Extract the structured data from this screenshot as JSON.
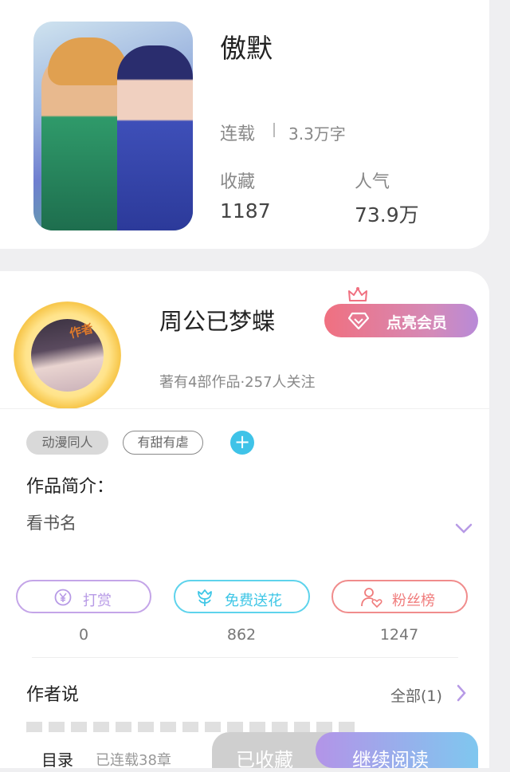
{
  "book": {
    "title": "傲默",
    "status": "连载",
    "word_count": "3.3万字",
    "stats": [
      {
        "label": "收藏",
        "value": "1187"
      },
      {
        "label": "人气",
        "value": "73.9万"
      }
    ]
  },
  "author": {
    "badge": "作者",
    "name": "周公已梦蝶",
    "vip_button": "点亮会员",
    "meta": "著有4部作品·257人关注"
  },
  "tags": [
    "动漫同人",
    "有甜有虐"
  ],
  "add_tag": "+",
  "intro": {
    "heading": "作品简介：",
    "text": "看书名"
  },
  "actions": [
    {
      "label": "打赏",
      "count": "0"
    },
    {
      "label": "免费送花",
      "count": "862"
    },
    {
      "label": "粉丝榜",
      "count": "1247"
    }
  ],
  "author_says": {
    "heading": "作者说",
    "all_link": "全部(1)"
  },
  "bottom_bar": {
    "toc": "目录",
    "chapters": "已连载38章",
    "favorite": "已收藏",
    "read": "继续阅读"
  },
  "colors": {
    "vip_gradient_start": "#f07080",
    "vip_gradient_end": "#b88ad8",
    "reward": "#b79ae6",
    "flower": "#3ec6e6",
    "fans": "#f07c7c",
    "read_gradient_start": "#b394e8",
    "read_gradient_end": "#7fc7ef"
  },
  "icons": [
    "diamond-icon",
    "crown-icon",
    "plus-icon",
    "chevron-down-icon",
    "yen-icon",
    "flower-icon",
    "user-heart-icon",
    "chevron-right-icon"
  ]
}
